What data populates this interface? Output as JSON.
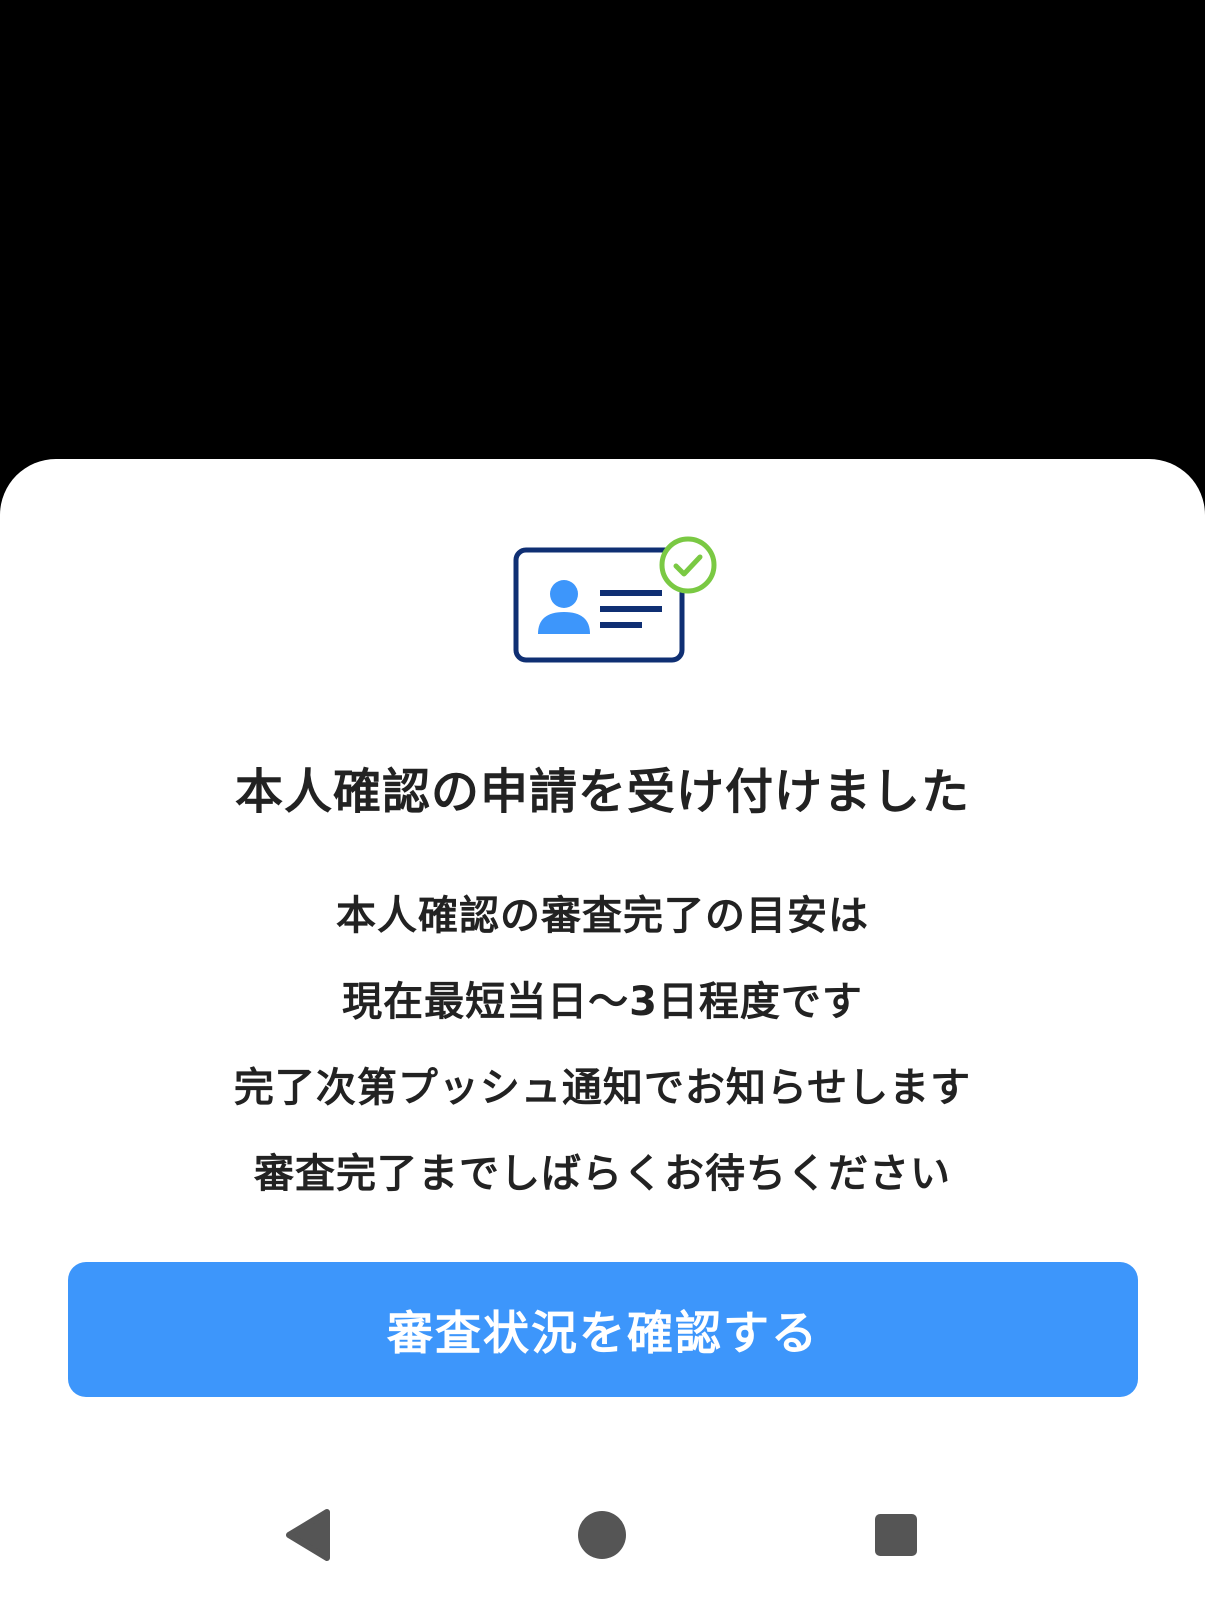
{
  "dialog": {
    "title": "本人確認の申請を受け付けました",
    "message_lines": [
      "本人確認の審査完了の目安は",
      "現在最短当日〜3日程度です",
      "完了次第プッシュ通知でお知らせします",
      "審査完了までしばらくお待ちください"
    ],
    "primary_button_label": "審査状況を確認する",
    "illustration_icon": "id-card-verified-icon"
  },
  "navigation_bar": {
    "back_icon": "triangle-back-icon",
    "home_icon": "circle-home-icon",
    "recents_icon": "square-recents-icon"
  },
  "colors": {
    "accent": "#3d96fb",
    "card_outline": "#0f2f73",
    "avatar": "#3d96fb",
    "check": "#7ac943",
    "text": "#222222",
    "nav_icon": "#555555"
  }
}
